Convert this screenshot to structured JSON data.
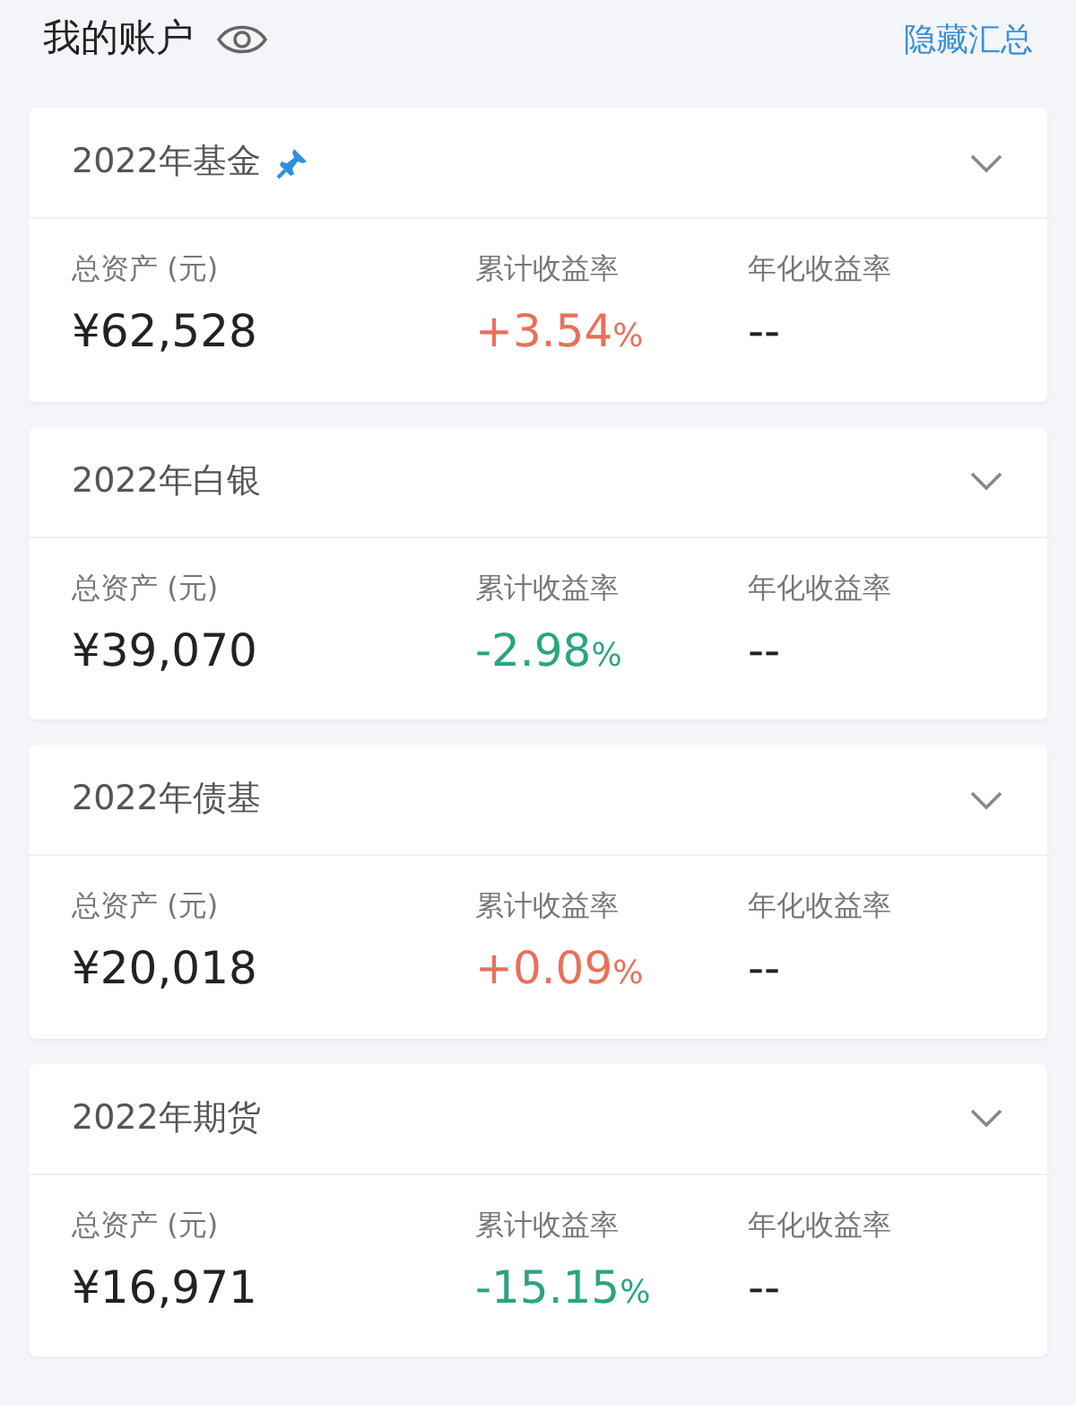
{
  "header": {
    "title": "我的账户",
    "action": "隐藏汇总"
  },
  "accounts": [
    {
      "name": "2022年基金",
      "pinned": true,
      "expanded": false,
      "total_label": "总资产 (元)",
      "total": "¥62,528",
      "rate_label": "累计收益率",
      "rate": "+3.54",
      "rate_unit": "%",
      "color": "#e9705a",
      "annual_label": "年化收益率",
      "annual": "--"
    },
    {
      "name": "2022年白银",
      "pinned": false,
      "expanded": false,
      "total_label": "总资产 (元)",
      "total": "¥39,070",
      "rate_label": "累计收益率",
      "rate": "-2.98",
      "rate_unit": "%",
      "color": "#2aa57f",
      "annual_label": "年化收益率",
      "annual": "--"
    },
    {
      "name": "2022年债基",
      "pinned": false,
      "expanded": false,
      "total_label": "总资产 (元)",
      "total": "¥20,018",
      "rate_label": "累计收益率",
      "rate": "+0.09",
      "rate_unit": "%",
      "color": "#e9705a",
      "annual_label": "年化收益率",
      "annual": "--"
    },
    {
      "name": "2022年期货",
      "pinned": false,
      "expanded": false,
      "total_label": "总资产 (元)",
      "total": "¥16,971",
      "rate_label": "累计收益率",
      "rate": "-15.15",
      "rate_unit": "%",
      "color": "#2aa57f",
      "annual_label": "年化收益率",
      "annual": "--"
    }
  ]
}
